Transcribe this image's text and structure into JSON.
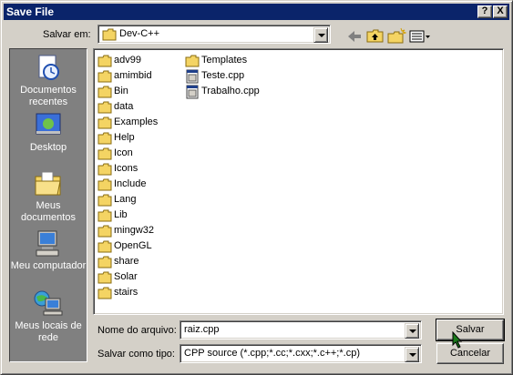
{
  "window": {
    "title": "Save File"
  },
  "caption_buttons": {
    "help": "?",
    "close": "X"
  },
  "location": {
    "label": "Salvar em:",
    "value": "Dev-C++"
  },
  "toolbar": {
    "icons": [
      "back-arrow-icon",
      "up-one-level-icon",
      "create-new-folder-icon",
      "view-menu-icon"
    ]
  },
  "places": [
    {
      "label": "Documentos recentes",
      "icon": "recent-documents-icon"
    },
    {
      "label": "Desktop",
      "icon": "desktop-icon"
    },
    {
      "label": "Meus documentos",
      "icon": "my-documents-icon"
    },
    {
      "label": "Meu computador",
      "icon": "my-computer-icon"
    },
    {
      "label": "Meus locais de rede",
      "icon": "network-places-icon"
    }
  ],
  "files": {
    "column1": [
      {
        "name": "adv99",
        "type": "folder"
      },
      {
        "name": "amimbid",
        "type": "folder"
      },
      {
        "name": "Bin",
        "type": "folder"
      },
      {
        "name": "data",
        "type": "folder"
      },
      {
        "name": "Examples",
        "type": "folder"
      },
      {
        "name": "Help",
        "type": "folder"
      },
      {
        "name": "Icon",
        "type": "folder"
      },
      {
        "name": "Icons",
        "type": "folder"
      },
      {
        "name": "Include",
        "type": "folder"
      },
      {
        "name": "Lang",
        "type": "folder"
      },
      {
        "name": "Lib",
        "type": "folder"
      },
      {
        "name": "mingw32",
        "type": "folder"
      },
      {
        "name": "OpenGL",
        "type": "folder"
      },
      {
        "name": "share",
        "type": "folder"
      },
      {
        "name": "Solar",
        "type": "folder"
      },
      {
        "name": "stairs",
        "type": "folder"
      }
    ],
    "column2": [
      {
        "name": "Templates",
        "type": "folder"
      },
      {
        "name": "Teste.cpp",
        "type": "cpp"
      },
      {
        "name": "Trabalho.cpp",
        "type": "cpp"
      }
    ]
  },
  "filename": {
    "label": "Nome do arquivo:",
    "value": "raiz.cpp"
  },
  "filetype": {
    "label": "Salvar como tipo:",
    "value": "CPP source (*.cpp;*.cc;*.cxx;*.c++;*.cp)"
  },
  "buttons": {
    "save": "Salvar",
    "cancel": "Cancelar"
  },
  "colors": {
    "titlebar": "#0a246a",
    "folder": "#f4d463",
    "places_bg": "#808080"
  }
}
